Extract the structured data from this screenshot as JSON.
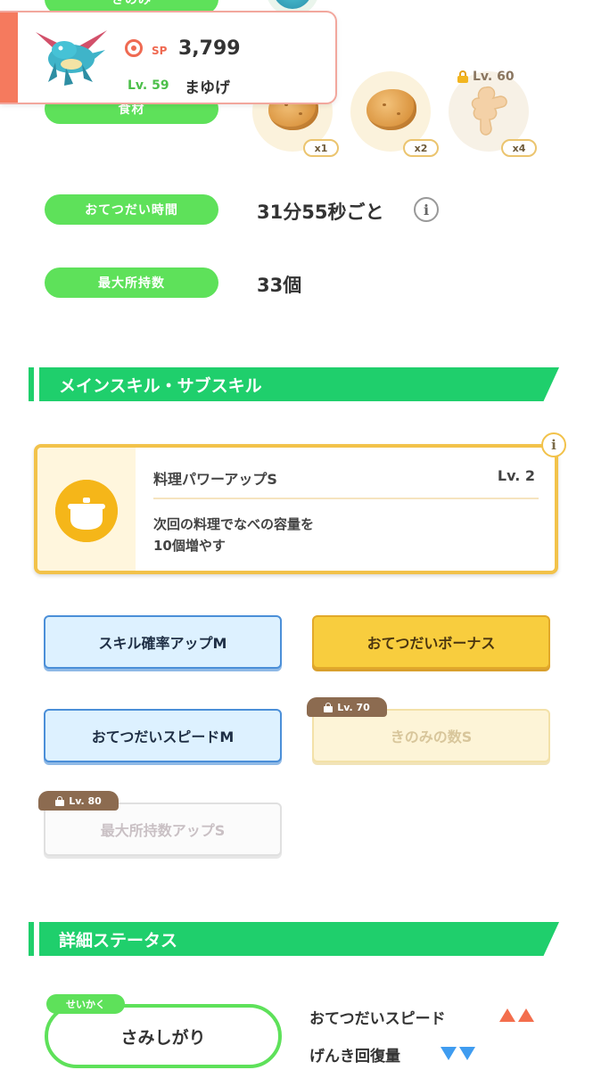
{
  "top_rows": {
    "berry_label": "きのみ",
    "ingredient_label": "食材",
    "ingredients": [
      {
        "name": "potato",
        "qty": "x1",
        "locked": false
      },
      {
        "name": "potato",
        "qty": "x2",
        "locked": false
      },
      {
        "name": "ginger",
        "qty": "x4",
        "locked": true,
        "unlock_level": "Lv. 60"
      }
    ]
  },
  "header": {
    "sp_label": "SP",
    "sp_value": "3,799",
    "level": "Lv. 59",
    "name": "まゆげ",
    "accent_color": "#f57a5e"
  },
  "stats": {
    "help_time_label": "おてつだい時間",
    "help_time_value": "31分55秒ごと",
    "max_carry_label": "最大所持数",
    "max_carry_value": "33個"
  },
  "skills_section": {
    "title": "メインスキル・サブスキル",
    "main_skill": {
      "name": "料理パワーアップS",
      "level": "Lv. 2",
      "description_line1": "次回の料理でなべの容量を",
      "description_line2": "10個増やす",
      "icon": "pot-icon"
    },
    "sub_skills": [
      {
        "label": "スキル確率アップM",
        "style": "blue",
        "locked": false
      },
      {
        "label": "おてつだいボーナス",
        "style": "gold",
        "locked": false
      },
      {
        "label": "おてつだいスピードM",
        "style": "blue",
        "locked": false
      },
      {
        "label": "きのみの数S",
        "style": "gold",
        "locked": true,
        "unlock_level": "Lv. 70"
      },
      {
        "label": "最大所持数アップS",
        "style": "white",
        "locked": true,
        "unlock_level": "Lv. 80"
      }
    ]
  },
  "details_section": {
    "title": "詳細ステータス",
    "nature_tag": "せいかく",
    "nature": "さみしがり",
    "effects": [
      {
        "label": "おてつだいスピード",
        "direction": "up",
        "color": "#f36e4d"
      },
      {
        "label": "げんき回復量",
        "direction": "down",
        "color": "#3f9cf0"
      }
    ]
  },
  "colors": {
    "green": "#5ee15a",
    "section_green": "#1fcf6c",
    "gold": "#f2c24a",
    "blue_border": "#4b8fd8"
  }
}
